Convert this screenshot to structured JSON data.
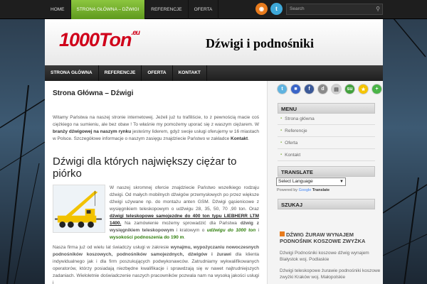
{
  "top_nav": {
    "items": [
      "Home",
      "Strona Główna – Dźwigi",
      "Referencje",
      "Oferta"
    ],
    "active_index": 1
  },
  "search": {
    "placeholder": "Search"
  },
  "header": {
    "logo_text": "1000Ton",
    "logo_suffix": ".eu",
    "tagline": "Dźwigi i podnośniki"
  },
  "main_nav": {
    "items": [
      "Strona Główna",
      "Referencje",
      "Oferta",
      "Kontakt"
    ]
  },
  "content": {
    "page_title": "Strona Główna – Dźwigi",
    "intro": [
      "Witamy Państwa na naszej stronie internetowej. Jeżeli już tu trafiliście, to z pewnością macie coś ciężkiego na sumieniu, ale bez obaw ! To właśnie my pomożemy uporać się z waszym ciężarem. W ",
      "branży dźwigowej na naszym rynku",
      " jesteśmy liderem, gdyż swoje usługi oferujemy w 16 miastach w Polsce. Szczegółowe informacje o naszym zasięgu znajdziecie Państwo w zakładce ",
      "Kontakt",
      "."
    ],
    "heading": "Dźwigi dla których największy ciężar to piórko",
    "article_1": [
      "W naszej skromnej ofercie znajdziecie Państwo wszelkiego rodzaju dźwigi. Od małych mobilnych dźwigów przemysłowych po przez większe dźwigi używane np. do montażu anten GSM. Dźwigi gąsienicowe z wysięgnikiem teleskopowym o udźwigu 28, 35, 50, 70 ,90 ton. Oraz ",
      "dźwigi teleskopowe samojezdne do 400 ton typu LIEBHERR LTM 1400.",
      " Na zamówienie możemy sprowadzić dla Państwa ",
      "dźwig z wysięgnikiem teleskopowym",
      " i kratowym o ",
      "udźwigu do 1000 ton",
      " i ",
      "wysokości podnoszenia do 190 m",
      "."
    ],
    "article_2": [
      "Nasza firma już od wielu lat świadczy usługi w zakresie ",
      "wynajmu, wypożyczaniu nowoczesnych podnośników koszowych, podnośników samojezdnych, dźwigów i żurawi",
      " dla klienta indywidualnego jak i dla firm poszukujących podwykonawców. Zatrudniamy wykwalifikowanych operatorów, którzy posiadają niezbędne kwalifikacje i sprawdzają się w nawet najtrudniejszych zadaniach. Wieloletnie doświadczenie naszych pracowników pozwala nam na wysoką jakości usługi i"
    ]
  },
  "sidebar": {
    "social_icons": [
      "twitter-icon",
      "delicious-icon",
      "facebook-icon",
      "digg-icon",
      "print-icon",
      "stumbleupon-icon",
      "favorite-icon",
      "add-icon"
    ],
    "menu_title": "Menu",
    "menu_items": [
      "Strona główna",
      "Referencje",
      "Oferta",
      "Kontakt"
    ],
    "translate_title": "Translate",
    "language_select": "Select Language",
    "powered_by": "Powered by",
    "google_label": "Google",
    "translate_label": "Translate",
    "search_title": "Szukaj",
    "feed_title": "Dźwig żuraw wynajem podnośnik koszowe zwyżka",
    "feed_items": [
      "Dźwigi Podnośniki koszowe dźwig wynajem Białystok woj. Podlaskie",
      "Dźwigi teleskopowe żurawie podnośniki koszowe zwyżki Kraków woj. Małopolskie"
    ]
  },
  "colors": {
    "accent_green": "#8cc63f",
    "logo_red": "#d0001a",
    "rss_orange": "#e87b1d",
    "twitter_blue": "#3ea8d8"
  }
}
